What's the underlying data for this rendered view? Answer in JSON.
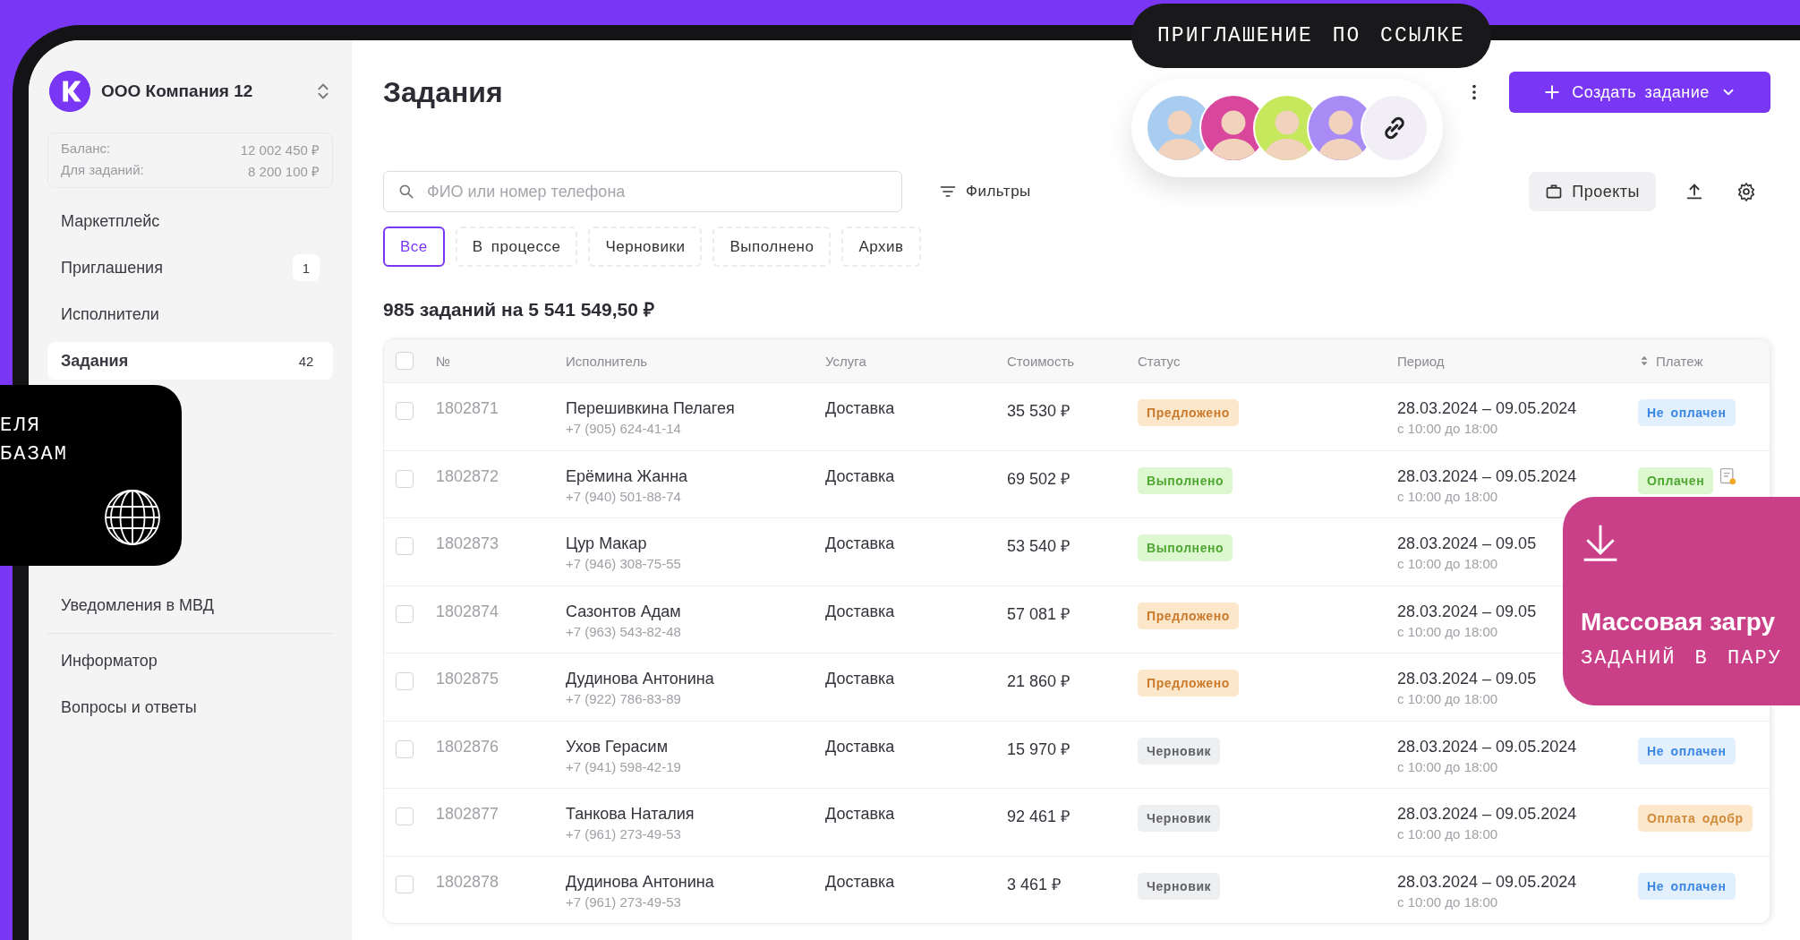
{
  "sidebar": {
    "company": "ООО Компания 12",
    "balance": [
      {
        "label": "Баланс:",
        "value": "12 002 450 ₽"
      },
      {
        "label": "Для заданий:",
        "value": "8 200 100 ₽"
      }
    ],
    "items": [
      {
        "label": "Маркетплейс",
        "selected": false
      },
      {
        "label": "Приглашения",
        "badge": "1",
        "selected": false
      },
      {
        "label": "Исполнители",
        "selected": false
      },
      {
        "label": "Задания",
        "badge": "42",
        "selected": true
      },
      {
        "label": "Уведомления в МВД",
        "selected": false
      }
    ],
    "footer_items": [
      {
        "label": "Информатор",
        "selected": false
      },
      {
        "label": "Вопросы и ответы",
        "selected": false
      }
    ]
  },
  "promo_left": {
    "lines": [
      "ЕЛЯ",
      "БАЗАМ"
    ]
  },
  "page": {
    "title": "Задания",
    "create_button": "Создать задание",
    "search": {
      "placeholder": "ФИО или номер телефона"
    },
    "filters_button": "Фильтры",
    "projects_button": "Проекты",
    "tabs": [
      {
        "label": "Все",
        "selected": true
      },
      {
        "label": "В процессе",
        "selected": false
      },
      {
        "label": "Черновики",
        "selected": false
      },
      {
        "label": "Выполнено",
        "selected": false
      },
      {
        "label": "Архив",
        "selected": false
      }
    ],
    "summary": "985 заданий на 5 541 549,50 ₽"
  },
  "invite": {
    "tooltip": "ПРИГЛАШЕНИЕ ПО ССЫЛКЕ",
    "avatars": [
      {
        "color": "#a9cdf0"
      },
      {
        "color": "#d9479c"
      },
      {
        "color": "#c6e85c"
      },
      {
        "color": "#a98bf5"
      }
    ]
  },
  "table": {
    "select_all": {
      "checked": false
    },
    "columns": [
      {
        "label": "№",
        "sortable": false
      },
      {
        "label": "Исполнитель",
        "sortable": false
      },
      {
        "label": "Услуга",
        "sortable": false
      },
      {
        "label": "Стоимость",
        "sortable": false
      },
      {
        "label": "Статус",
        "sortable": false
      },
      {
        "label": "Период",
        "sortable": false
      },
      {
        "label": "Платеж",
        "sortable": true
      }
    ],
    "rows": [
      {
        "checked": false,
        "number": "1802871",
        "name": "Перешивкина Пелагея",
        "phone": "+7 (905) 624-41-14",
        "service": "Доставка",
        "cost": "35 530 ₽",
        "status": {
          "label": "Предложено",
          "kind": "offered"
        },
        "period": "28.03.2024 – 09.05.2024",
        "time": "с 10:00 до 18:00",
        "payment": {
          "label": "Не оплачен",
          "kind": "unpaid"
        },
        "document": false
      },
      {
        "checked": false,
        "number": "1802872",
        "name": "Ерёмина Жанна",
        "phone": "+7 (940) 501-88-74",
        "service": "Доставка",
        "cost": "69 502 ₽",
        "status": {
          "label": "Выполнено",
          "kind": "done"
        },
        "period": "28.03.2024 – 09.05.2024",
        "time": "с 10:00 до 18:00",
        "payment": {
          "label": "Оплачен",
          "kind": "paid"
        },
        "document": true
      },
      {
        "checked": false,
        "number": "1802873",
        "name": "Цур Макар",
        "phone": "+7 (946) 308-75-55",
        "service": "Доставка",
        "cost": "53 540 ₽",
        "status": {
          "label": "Выполнено",
          "kind": "done"
        },
        "period": "28.03.2024 – 09.05",
        "time": "с 10:00 до 18:00",
        "document": false
      },
      {
        "checked": false,
        "number": "1802874",
        "name": "Сазонтов Адам",
        "phone": "+7 (963) 543-82-48",
        "service": "Доставка",
        "cost": "57 081 ₽",
        "status": {
          "label": "Предложено",
          "kind": "offered"
        },
        "period": "28.03.2024 – 09.05",
        "time": "с 10:00 до 18:00",
        "document": false
      },
      {
        "checked": false,
        "number": "1802875",
        "name": "Дудинова Антонина",
        "phone": "+7 (922) 786-83-89",
        "service": "Доставка",
        "cost": "21 860 ₽",
        "status": {
          "label": "Предложено",
          "kind": "offered"
        },
        "period": "28.03.2024 – 09.05",
        "time": "с 10:00 до 18:00",
        "document": false
      },
      {
        "checked": false,
        "number": "1802876",
        "name": "Ухов Герасим",
        "phone": "+7 (941) 598-42-19",
        "service": "Доставка",
        "cost": "15 970 ₽",
        "status": {
          "label": "Черновик",
          "kind": "draft"
        },
        "period": "28.03.2024 – 09.05.2024",
        "time": "с 10:00 до 18:00",
        "payment": {
          "label": "Не оплачен",
          "kind": "unpaid"
        },
        "document": false
      },
      {
        "checked": false,
        "number": "1802877",
        "name": "Танкова Наталия",
        "phone": "+7 (961) 273-49-53",
        "service": "Доставка",
        "cost": "92 461 ₽",
        "status": {
          "label": "Черновик",
          "kind": "draft"
        },
        "period": "28.03.2024 – 09.05.2024",
        "time": "с 10:00 до 18:00",
        "payment": {
          "label": "Оплата одобр",
          "kind": "approved"
        },
        "document": false
      },
      {
        "checked": false,
        "number": "1802878",
        "name": "Дудинова Антонина",
        "phone": "+7 (961) 273-49-53",
        "service": "Доставка",
        "cost": "3 461 ₽",
        "status": {
          "label": "Черновик",
          "kind": "draft"
        },
        "period": "28.03.2024 – 09.05.2024",
        "time": "с 10:00 до 18:00",
        "payment": {
          "label": "Не оплачен",
          "kind": "unpaid"
        },
        "document": false
      }
    ]
  },
  "promo_right": {
    "title": "Массовая загру",
    "subtitle": "ЗАДАНИЙ В ПАРУ"
  }
}
